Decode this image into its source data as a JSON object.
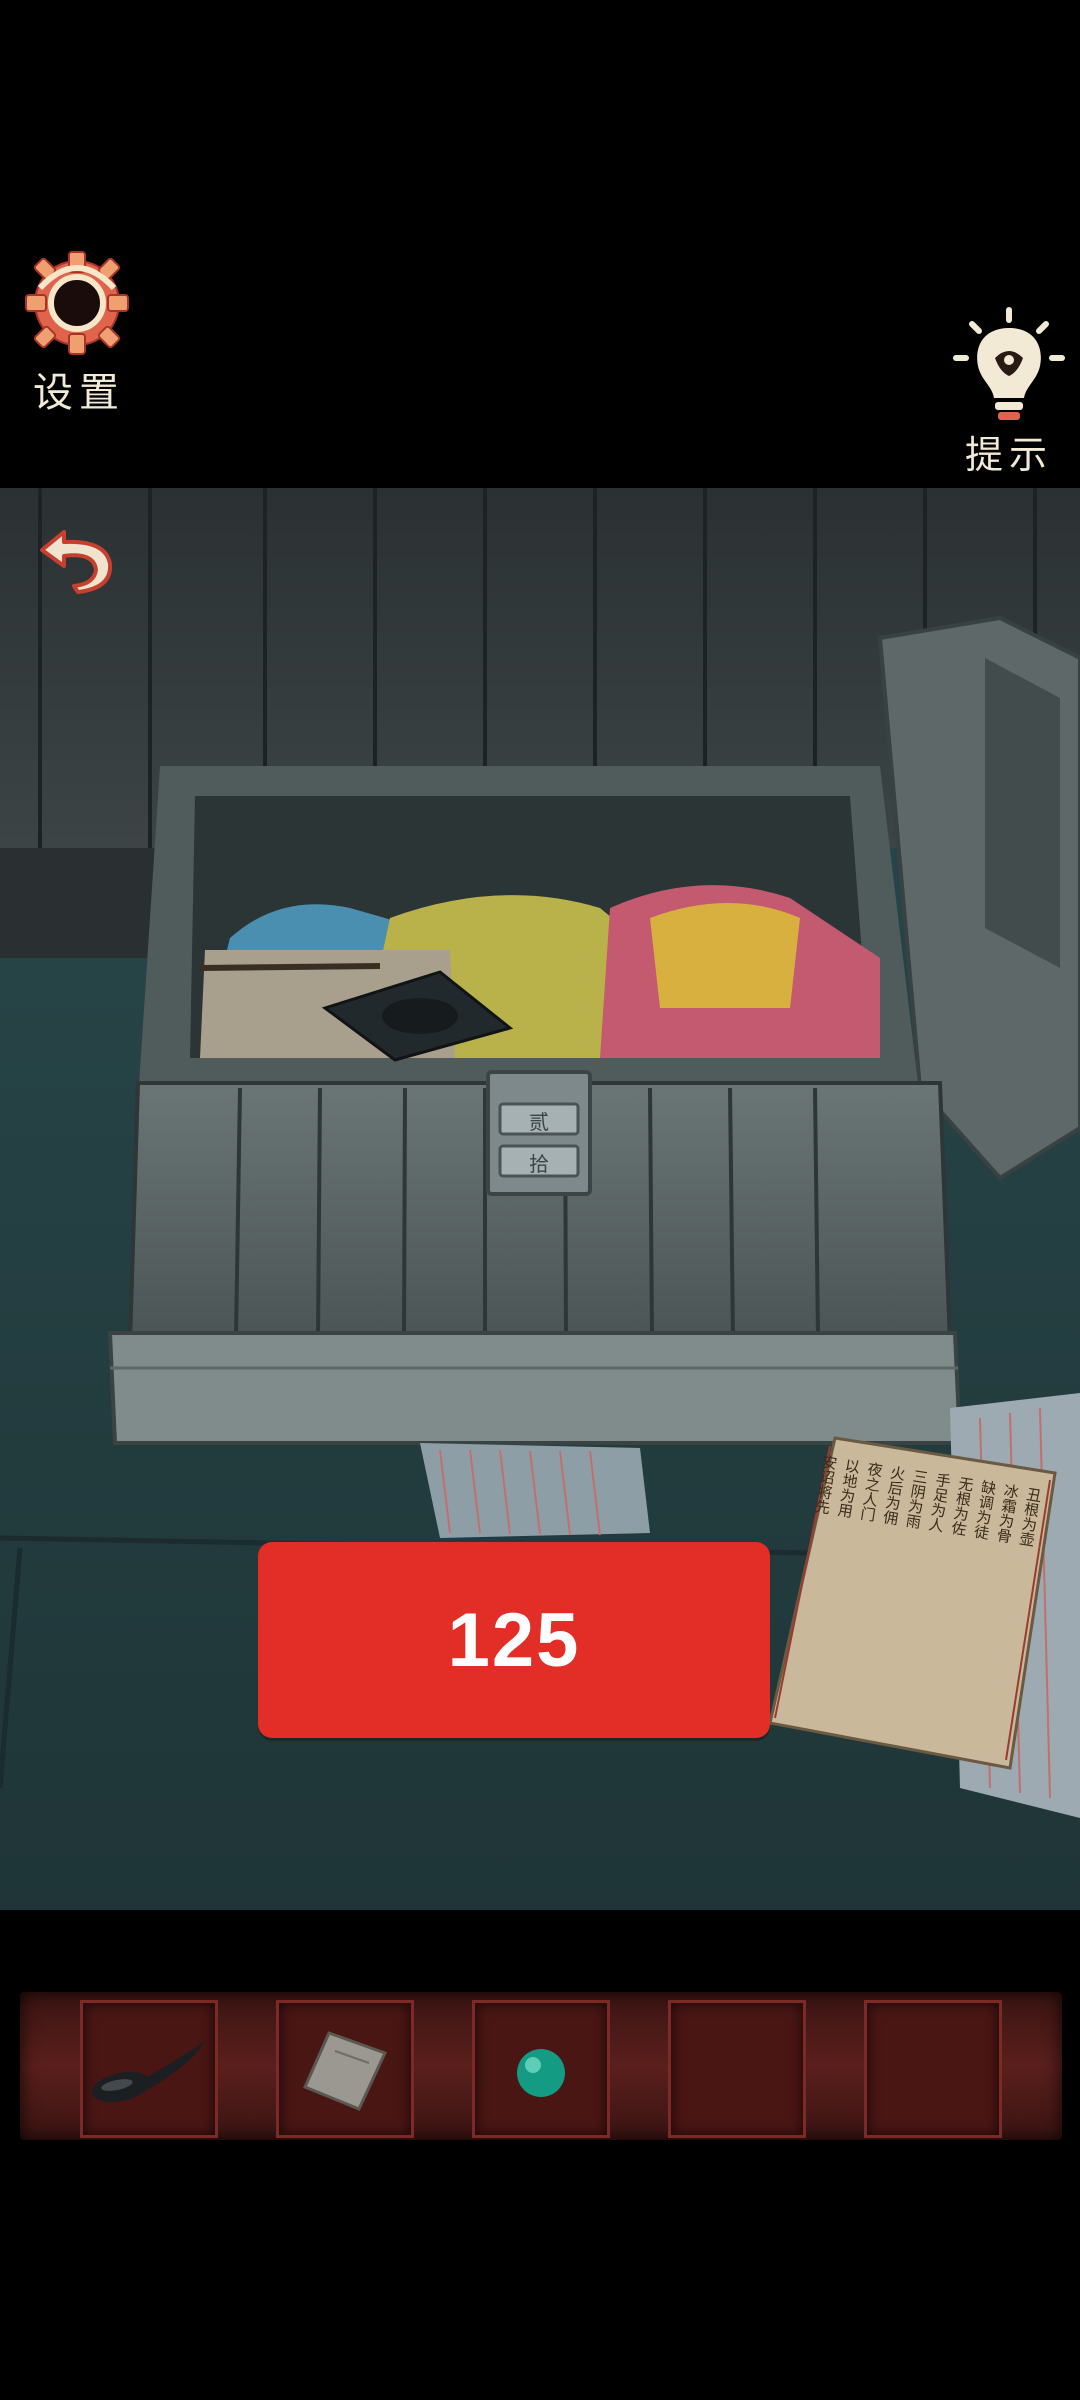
{
  "header": {
    "settings_label": "设置",
    "hint_label": "提示"
  },
  "puzzle": {
    "code_display": "125"
  },
  "scene": {
    "lock_top_glyph": "贰",
    "lock_bottom_glyph": "拾",
    "scroll_columns": [
      "丑根为壶",
      "冰霜为骨",
      "缺调为徒",
      "无根为佐",
      "手足为人",
      "三阴为雨",
      "火后为佣",
      "夜之人门",
      "以地为用",
      "安诏将先"
    ]
  },
  "inventory": {
    "slots": [
      {
        "item": "spoon-icon"
      },
      {
        "item": "paper-note-icon"
      },
      {
        "item": "jade-bead-icon"
      },
      {
        "item": ""
      },
      {
        "item": ""
      }
    ]
  },
  "colors": {
    "code_box": "#e32d27",
    "inventory_frame": "#7c2a26",
    "label_text": "#f3ead6"
  }
}
